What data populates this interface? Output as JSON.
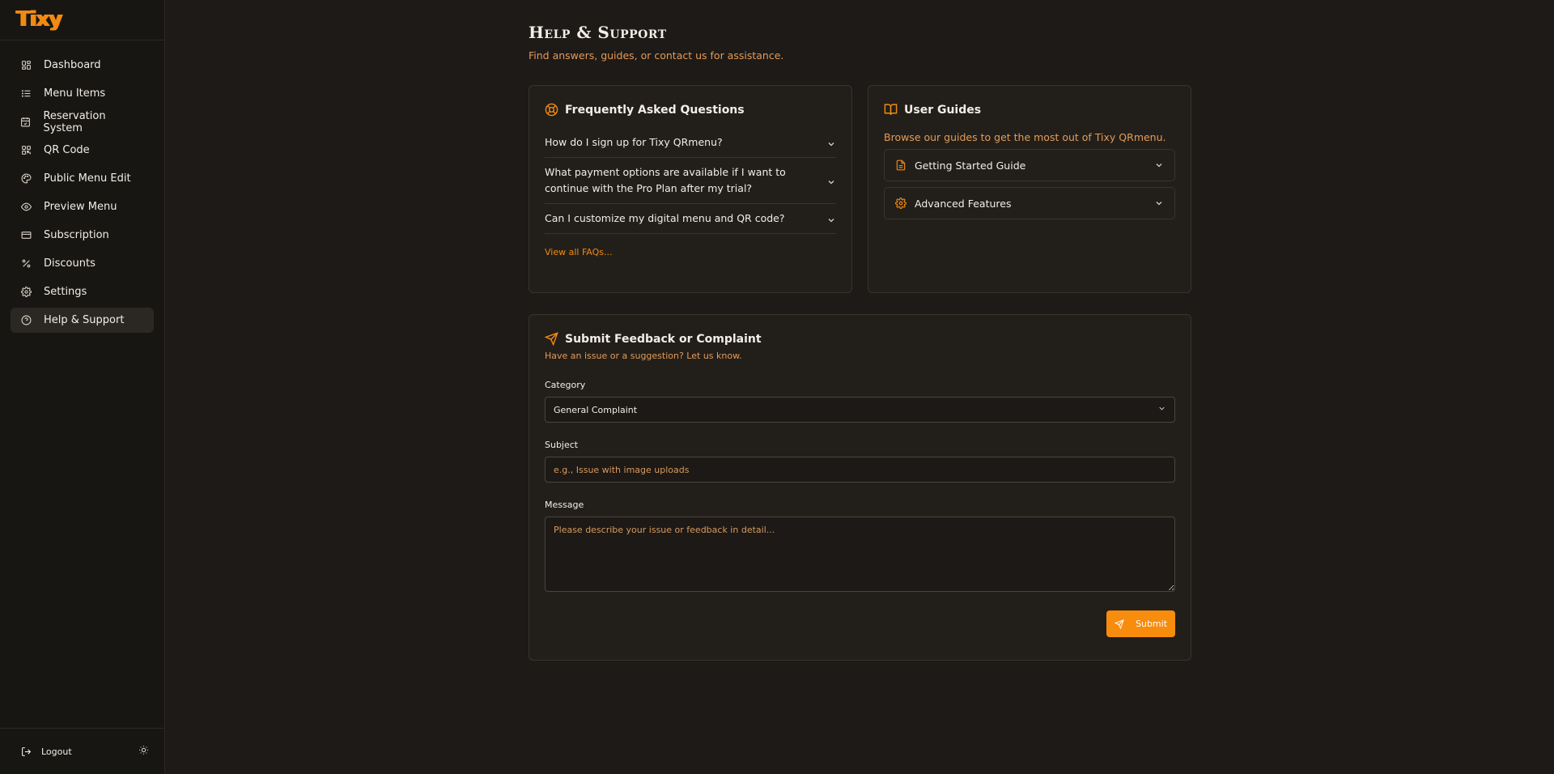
{
  "brand": {
    "logo_text": "Tixy",
    "accent": "#f88c0d"
  },
  "sidebar": {
    "items": [
      {
        "label": "Dashboard",
        "icon": "dashboard-icon"
      },
      {
        "label": "Menu Items",
        "icon": "list-icon"
      },
      {
        "label": "Reservation System",
        "icon": "calendar-icon"
      },
      {
        "label": "QR Code",
        "icon": "qr-icon"
      },
      {
        "label": "Public Menu Edit",
        "icon": "palette-icon"
      },
      {
        "label": "Preview Menu",
        "icon": "eye-icon"
      },
      {
        "label": "Subscription",
        "icon": "credit-card-icon"
      },
      {
        "label": "Discounts",
        "icon": "percent-icon"
      },
      {
        "label": "Settings",
        "icon": "gear-icon"
      },
      {
        "label": "Help & Support",
        "icon": "help-circle-icon",
        "active": true
      }
    ],
    "logout_label": "Logout"
  },
  "page": {
    "title": "Help & Support",
    "subtitle": "Find answers, guides, or contact us for assistance."
  },
  "faq": {
    "title": "Frequently Asked Questions",
    "questions": [
      "How do I sign up for Tixy QRmenu?",
      "What payment options are available if I want to continue with the Pro Plan after my trial?",
      "Can I customize my digital menu and QR code?"
    ],
    "view_all": "View all FAQs..."
  },
  "guides": {
    "title": "User Guides",
    "description": "Browse our guides to get the most out of Tixy QRmenu.",
    "items": [
      {
        "label": "Getting Started Guide",
        "icon": "document-icon"
      },
      {
        "label": "Advanced Features",
        "icon": "gear-icon"
      }
    ]
  },
  "feedback": {
    "title": "Submit Feedback or Complaint",
    "description": "Have an issue or a suggestion? Let us know.",
    "category_label": "Category",
    "category_value": "General Complaint",
    "subject_label": "Subject",
    "subject_placeholder": "e.g., Issue with image uploads",
    "message_label": "Message",
    "message_placeholder": "Please describe your issue or feedback in detail...",
    "submit_label": "Submit"
  }
}
